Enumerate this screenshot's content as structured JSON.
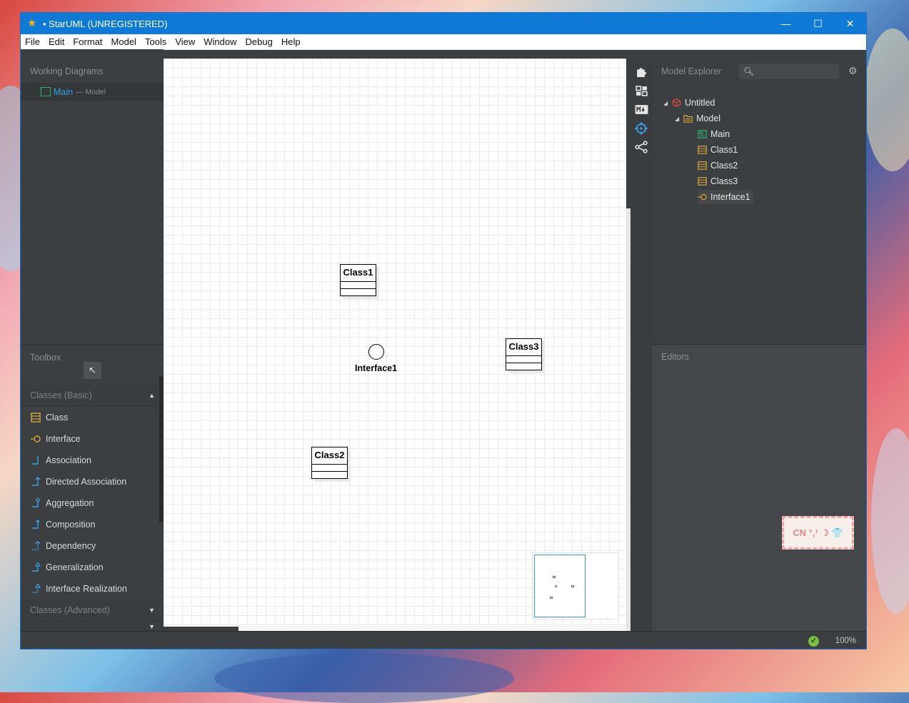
{
  "window": {
    "title": "• StarUML (UNREGISTERED)",
    "controls": {
      "minimize": "—",
      "maximize": "☐",
      "close": "✕"
    }
  },
  "menu": [
    "File",
    "Edit",
    "Format",
    "Model",
    "Tools",
    "View",
    "Window",
    "Debug",
    "Help"
  ],
  "working_diagrams": {
    "title": "Working Diagrams",
    "item_name": "Main",
    "item_sep": "— Model"
  },
  "toolbox": {
    "title": "Toolbox",
    "pointer_glyph": "↖",
    "section_basic": "Classes (Basic)",
    "section_basic_toggle": "▲",
    "items": [
      "Class",
      "Interface",
      "Association",
      "Directed Association",
      "Aggregation",
      "Composition",
      "Dependency",
      "Generalization",
      "Interface Realization"
    ],
    "section_advanced": "Classes (Advanced)",
    "section_advanced_toggle": "▼",
    "section_third_toggle": "▼"
  },
  "diagram": {
    "classes": [
      {
        "name": "Class1"
      },
      {
        "name": "Class3"
      },
      {
        "name": "Class2"
      }
    ],
    "interface": {
      "name": "Interface1"
    }
  },
  "model_explorer": {
    "title": "Model Explorer",
    "search_placeholder": "",
    "tree": {
      "root": "Untitled",
      "model": "Model",
      "children": [
        "Main",
        "Class1",
        "Class2",
        "Class3",
        "Interface1"
      ]
    }
  },
  "editors": {
    "title": "Editors"
  },
  "status": {
    "zoom": "100%"
  },
  "ime": {
    "label": "CN °,¹ ☽ 👕"
  },
  "colors": {
    "titlebar": "#0f7ad6",
    "accent_blue": "#3aa0e8",
    "class_icon": "#d7a53a",
    "diagram_icon": "#2fb36a",
    "project_icon": "#e24b3b"
  }
}
